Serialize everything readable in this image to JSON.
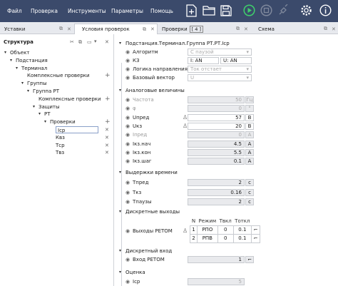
{
  "menu": [
    "Файл",
    "Проверка",
    "Инструменты",
    "Параметры",
    "Помощь"
  ],
  "toolbar": {
    "icons": [
      "new-file-icon",
      "open-folder-icon",
      "save-icon",
      "run-icon",
      "stop-icon",
      "connect-icon",
      "settings-icon",
      "info-icon"
    ]
  },
  "tabs": [
    {
      "label": "Уставки",
      "active": false
    },
    {
      "label": "Условия проверок",
      "active": true
    },
    {
      "label": "Проверки",
      "badge": "[ 4 ]",
      "active": false
    },
    {
      "label": "Схема",
      "active": false
    }
  ],
  "tree": {
    "title": "Структура",
    "items": [
      {
        "label": "Объект",
        "level": 0,
        "arrow": "▾"
      },
      {
        "label": "Подстанция",
        "level": 1,
        "arrow": "▾"
      },
      {
        "label": "Терминал",
        "level": 2,
        "arrow": "▾"
      },
      {
        "label": "Комплексные проверки",
        "level": 3,
        "arrow": ""
      },
      {
        "label": "Группы",
        "level": 3,
        "arrow": "▾"
      },
      {
        "label": "Группа РТ",
        "level": 4,
        "arrow": "▾"
      },
      {
        "label": "Комплексные проверки",
        "level": 5,
        "arrow": ""
      },
      {
        "label": "Защиты",
        "level": 5,
        "arrow": "▾"
      },
      {
        "label": "РТ",
        "level": 6,
        "arrow": "▾"
      },
      {
        "label": "Проверки",
        "level": 7,
        "arrow": "▾"
      },
      {
        "label": "Iср",
        "level": 8,
        "arrow": ""
      },
      {
        "label": "Квз",
        "level": 8,
        "arrow": ""
      },
      {
        "label": "Тср",
        "level": 8,
        "arrow": ""
      },
      {
        "label": "Твз",
        "level": 8,
        "arrow": ""
      }
    ]
  },
  "panel": {
    "header": "Подстанция.Терминал.Группа РТ.РТ.Iср",
    "rows_top": [
      {
        "label": "Алгоритм",
        "value": "С паузой"
      },
      {
        "label": "КЗ",
        "value": "I: AN",
        "value2": "U: AN"
      },
      {
        "label": "Логика направления",
        "value": "Ток отстает"
      },
      {
        "label": "Базовый вектор",
        "value": "U"
      }
    ],
    "analog_title": "Аналоговые величины",
    "analog": [
      {
        "label": "Частота",
        "value": "50",
        "unit": "Гц",
        "dim": true
      },
      {
        "label": "φ",
        "value": "0",
        "unit": "°",
        "dim": true
      },
      {
        "label": "Uпред",
        "value": "57",
        "unit": "В",
        "dim": false
      },
      {
        "label": "Uкз",
        "value": "20",
        "unit": "В",
        "dim": false
      },
      {
        "label": "Iпред",
        "value": "0",
        "unit": "А",
        "dim": true
      },
      {
        "label": "Iкз.нач",
        "value": "4.5",
        "unit": "А",
        "dim": false
      },
      {
        "label": "Iкз.кон",
        "value": "5.5",
        "unit": "А",
        "dim": false
      },
      {
        "label": "Iкз.шаг",
        "value": "0.1",
        "unit": "А",
        "dim": false
      }
    ],
    "delay_title": "Выдержки времени",
    "delays": [
      {
        "label": "Тпред",
        "value": "2",
        "unit": "с"
      },
      {
        "label": "Ткз",
        "value": "0.16",
        "unit": "с"
      },
      {
        "label": "Тпаузы",
        "value": "2",
        "unit": "с"
      }
    ],
    "dout_title": "Дискретные выходы",
    "dout_label": "Выходы РЕТОМ",
    "dout_headers": [
      "N",
      "Режим",
      "Твкл",
      "Тоткл"
    ],
    "dout_rows": [
      [
        "1",
        "РПО",
        "0",
        "0.1"
      ],
      [
        "2",
        "РПВ",
        "0",
        "0.1"
      ]
    ],
    "din_title": "Дискретный вход",
    "din_label": "Вход РЕТОМ",
    "din_value": "1",
    "eval_title": "Оценка",
    "eval_label": "Iср",
    "eval_value": "5"
  }
}
